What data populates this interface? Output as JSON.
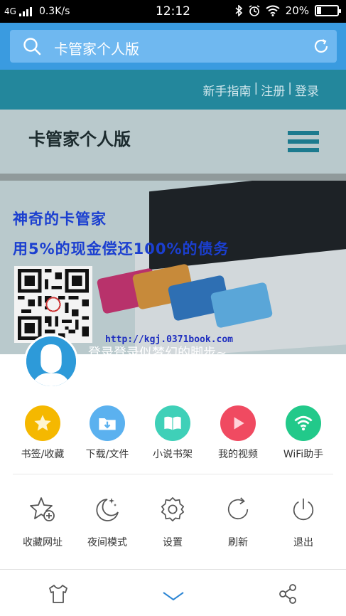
{
  "status_bar": {
    "network": "4G",
    "speed": "0.3K/s",
    "time": "12:12",
    "battery": "20%",
    "battery_level": 0.2
  },
  "search": {
    "placeholder": "卡管家个人版"
  },
  "web": {
    "top_links": [
      "新手指南",
      "|",
      "注册",
      "|",
      "登录"
    ],
    "site_title": "卡管家个人版",
    "slogan_line1": "神奇的卡管家",
    "slogan_line2": "用5%的现金偿还100%的债务",
    "url": "http://kgj.0371book.com"
  },
  "drawer": {
    "login_text": "登录登录似梦幻的脚步~",
    "quick_items": [
      {
        "label": "书签/收藏",
        "icon": "star-icon",
        "color": "#f5b800"
      },
      {
        "label": "下载/文件",
        "icon": "download-folder-icon",
        "color": "#5bb1ef"
      },
      {
        "label": "小说书架",
        "icon": "book-icon",
        "color": "#3fd0b8"
      },
      {
        "label": "我的视频",
        "icon": "play-icon",
        "color": "#f04a61"
      },
      {
        "label": "WiFi助手",
        "icon": "wifi-icon",
        "color": "#22c98a"
      }
    ],
    "tool_items": [
      {
        "label": "收藏网址",
        "icon": "star-add-icon"
      },
      {
        "label": "夜间模式",
        "icon": "moon-icon"
      },
      {
        "label": "设置",
        "icon": "gear-icon"
      },
      {
        "label": "刷新",
        "icon": "refresh-icon"
      },
      {
        "label": "退出",
        "icon": "power-icon"
      }
    ]
  },
  "bottom_bar": {
    "icons": [
      "tshirt-icon",
      "chevron-down-icon",
      "share-icon"
    ]
  }
}
